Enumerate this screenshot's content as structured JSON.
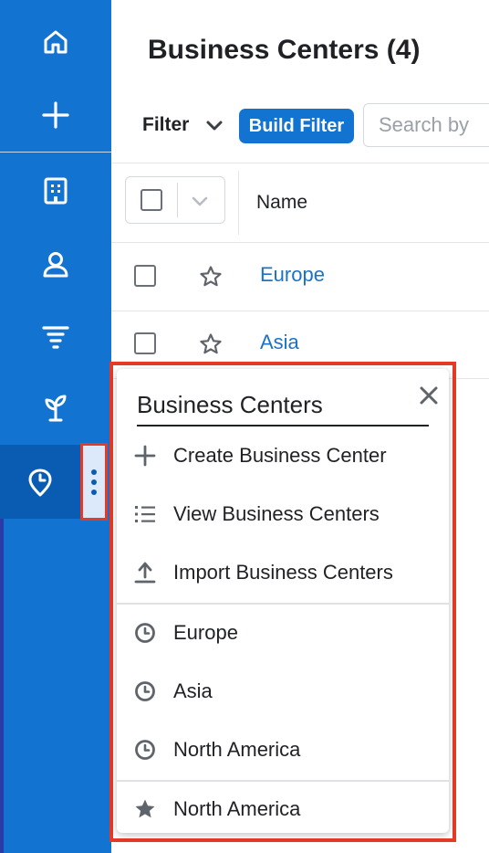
{
  "sidebar": {
    "items": [
      {
        "name": "home-icon"
      },
      {
        "name": "plus-icon"
      },
      {
        "name": "building-icon"
      },
      {
        "name": "contact-icon"
      },
      {
        "name": "funnel-icon"
      },
      {
        "name": "sprout-icon"
      },
      {
        "name": "business-center-icon"
      }
    ]
  },
  "header": {
    "title": "Business Centers (4)"
  },
  "toolbar": {
    "filter_label": "Filter",
    "build_filter_label": "Build Filter",
    "search_placeholder": "Search by"
  },
  "table": {
    "columns": [
      "Name"
    ],
    "rows": [
      {
        "name": "Europe"
      },
      {
        "name": "Asia"
      }
    ]
  },
  "dropdown": {
    "title": "Business Centers",
    "actions": [
      {
        "label": "Create Business Center",
        "icon": "plus-icon"
      },
      {
        "label": "View Business Centers",
        "icon": "list-icon"
      },
      {
        "label": "Import Business Centers",
        "icon": "upload-icon"
      }
    ],
    "recently_viewed": [
      {
        "label": "Europe",
        "icon": "clock-icon"
      },
      {
        "label": "Asia",
        "icon": "clock-icon"
      },
      {
        "label": "North America",
        "icon": "clock-icon"
      }
    ],
    "favorites": [
      {
        "label": "North America",
        "icon": "star-icon"
      }
    ]
  },
  "colors": {
    "sidebar": "#1273d1",
    "sidebar_active": "#0a5bb2",
    "highlight": "#e53a26",
    "link": "#1a73c6"
  }
}
